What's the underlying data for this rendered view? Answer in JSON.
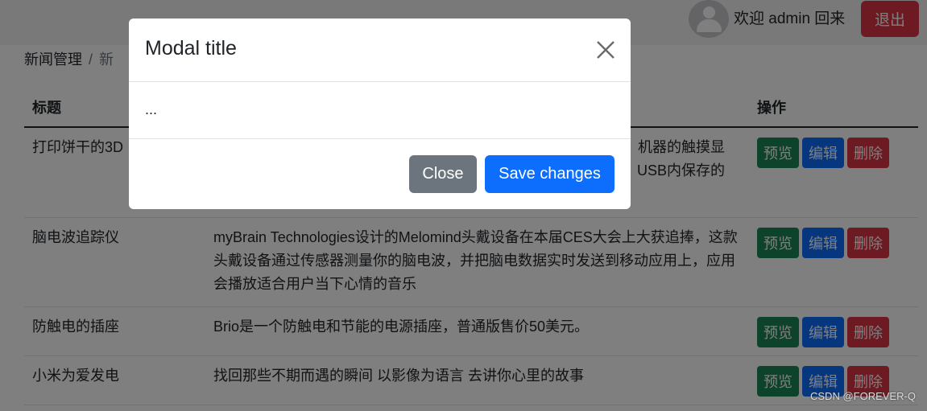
{
  "navbar": {
    "welcome": "欢迎 admin 回来",
    "logout": "退出"
  },
  "breadcrumb": [
    "新闻管理",
    "/",
    "新"
  ],
  "table": {
    "headers": [
      "标题",
      "",
      "操作"
    ],
    "rows": [
      {
        "title": "打印饼干的3D",
        "desc_lines": [
          "机器的触摸显",
          "USB内保存的"
        ]
      },
      {
        "title": "脑电波追踪仪",
        "desc": "myBrain Technologies设计的Melomind头戴设备在本届CES大会上大获追捧，这款头戴设备通过传感器测量你的脑电波，并把脑电数据实时发送到移动应用上，应用会播放适合用户当下心情的音乐"
      },
      {
        "title": "防触电的插座",
        "desc": "Brio是一个防触电和节能的电源插座，普通版售价50美元。"
      },
      {
        "title": "小米为爱发电",
        "desc": "找回那些不期而遇的瞬间 以影像为语言 去讲你心里的故事"
      }
    ],
    "actions": {
      "preview": "预览",
      "edit": "编辑",
      "delete": "删除"
    }
  },
  "modal": {
    "title": "Modal title",
    "body": "...",
    "close": "Close",
    "save": "Save changes"
  },
  "watermark": "CSDN @FOREVER-Q",
  "colors": {
    "success": "#198754",
    "primary": "#0d6efd",
    "danger": "#dc3545",
    "secondary": "#6c757d"
  }
}
